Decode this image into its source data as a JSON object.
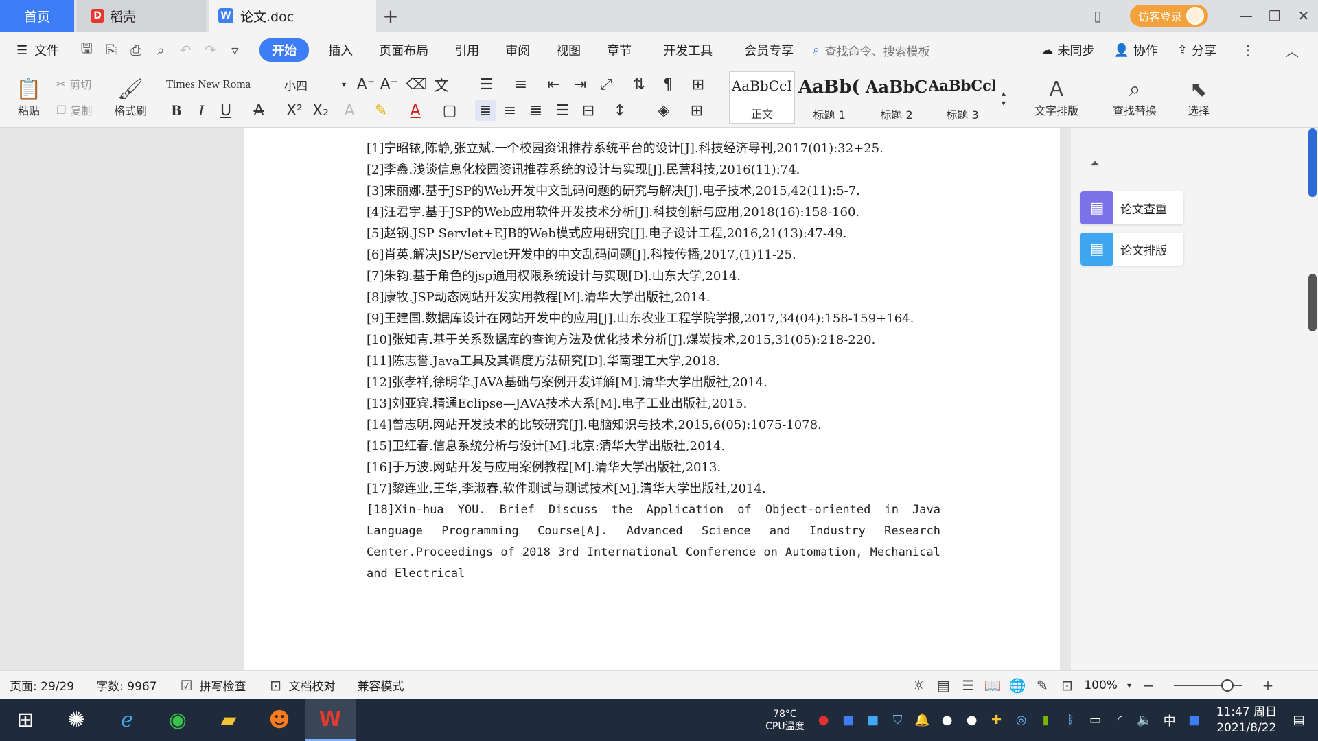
{
  "tabs": {
    "home": "首页",
    "daoke": "稻壳",
    "doc": "论文.doc",
    "add": "+"
  },
  "titlebar": {
    "login": "访客登录"
  },
  "menu": {
    "file": "文件",
    "items": [
      "开始",
      "插入",
      "页面布局",
      "引用",
      "审阅",
      "视图",
      "章节",
      "开发工具",
      "会员专享"
    ],
    "search_placeholder": "查找命令、搜索模板",
    "sync": "未同步",
    "collab": "协作",
    "share": "分享"
  },
  "ribbon": {
    "paste": "粘贴",
    "cut": "剪切",
    "copy": "复制",
    "format_painter": "格式刷",
    "font_name": "Times New Roma",
    "font_size": "小四",
    "styles": [
      {
        "sample": "AaBbCcI",
        "name": "正文"
      },
      {
        "sample": "AaBb(",
        "name": "标题 1"
      },
      {
        "sample": "AaBbC",
        "name": "标题 2"
      },
      {
        "sample": "AaBbCcl",
        "name": "标题 3"
      }
    ],
    "text_layout": "文字排版",
    "find_replace": "查找替换",
    "select": "选择"
  },
  "references": [
    "[1]宁昭铱,陈静,张立斌.一个校园资讯推荐系统平台的设计[J].科技经济导刊,2017(01):32+25.",
    "[2]李鑫.浅谈信息化校园资讯推荐系统的设计与实现[J].民营科技,2016(11):74.",
    "[3]宋丽娜.基于JSP的Web开发中文乱码问题的研究与解决[J].电子技术,2015,42(11):5-7.",
    "[4]汪君宇.基于JSP的Web应用软件开发技术分析[J].科技创新与应用,2018(16):158-160.",
    "[5]赵钢.JSP Servlet+EJB的Web模式应用研究[J].电子设计工程,2016,21(13):47-49.",
    "[6]肖英.解决JSP/Servlet开发中的中文乱码问题[J].科技传播,2017,(1)11-25.",
    "[7]朱钧.基于角色的jsp通用权限系统设计与实现[D].山东大学,2014.",
    "[8]康牧.JSP动态网站开发实用教程[M].清华大学出版社,2014.",
    "[9]王建国.数据库设计在网站开发中的应用[J].山东农业工程学院学报,2017,34(04):158-159+164.",
    "[10]张知青.基于关系数据库的查询方法及优化技术分析[J].煤炭技术,2015,31(05):218-220.",
    "[11]陈志誉.Java工具及其调度方法研究[D].华南理工大学,2018.",
    "[12]张孝祥,徐明华.JAVA基础与案例开发详解[M].清华大学出版社,2014.",
    "[13]刘亚宾.精通Eclipse—JAVA技术大系[M].电子工业出版社,2015.",
    "[14]曾志明.网站开发技术的比较研究[J].电脑知识与技术,2015,6(05):1075-1078.",
    "[15]卫红春.信息系统分析与设计[M].北京:清华大学出版社,2014.",
    "[16]于万波.网站开发与应用案例教程[M].清华大学出版社,2013.",
    "[17]黎连业,王华,李淑春.软件测试与测试技术[M].清华大学出版社,2014.",
    "[18]Xin-hua YOU. Brief Discuss the Application of Object-oriented in Java Language Programming Course[A]. Advanced Science and Industry Research Center.Proceedings of 2018 3rd International Conference on Automation, Mechanical and Electrical"
  ],
  "side_panel": {
    "check": "论文查重",
    "layout": "论文排版"
  },
  "status": {
    "page": "页面: 29/29",
    "words": "字数: 9967",
    "spell": "拼写检查",
    "proof": "文档校对",
    "compat": "兼容模式",
    "zoom": "100%",
    "zoom_fraction": 0.78
  },
  "taskbar": {
    "temp": "78°C",
    "temp_label": "CPU温度",
    "ime": "中",
    "time": "11:47 周日",
    "date": "2021/8/22"
  },
  "colors": {
    "accent": "#3d7df5",
    "login": "#f3a13a",
    "panel_check": "#7b72e9",
    "panel_layout": "#3ea6f0"
  }
}
